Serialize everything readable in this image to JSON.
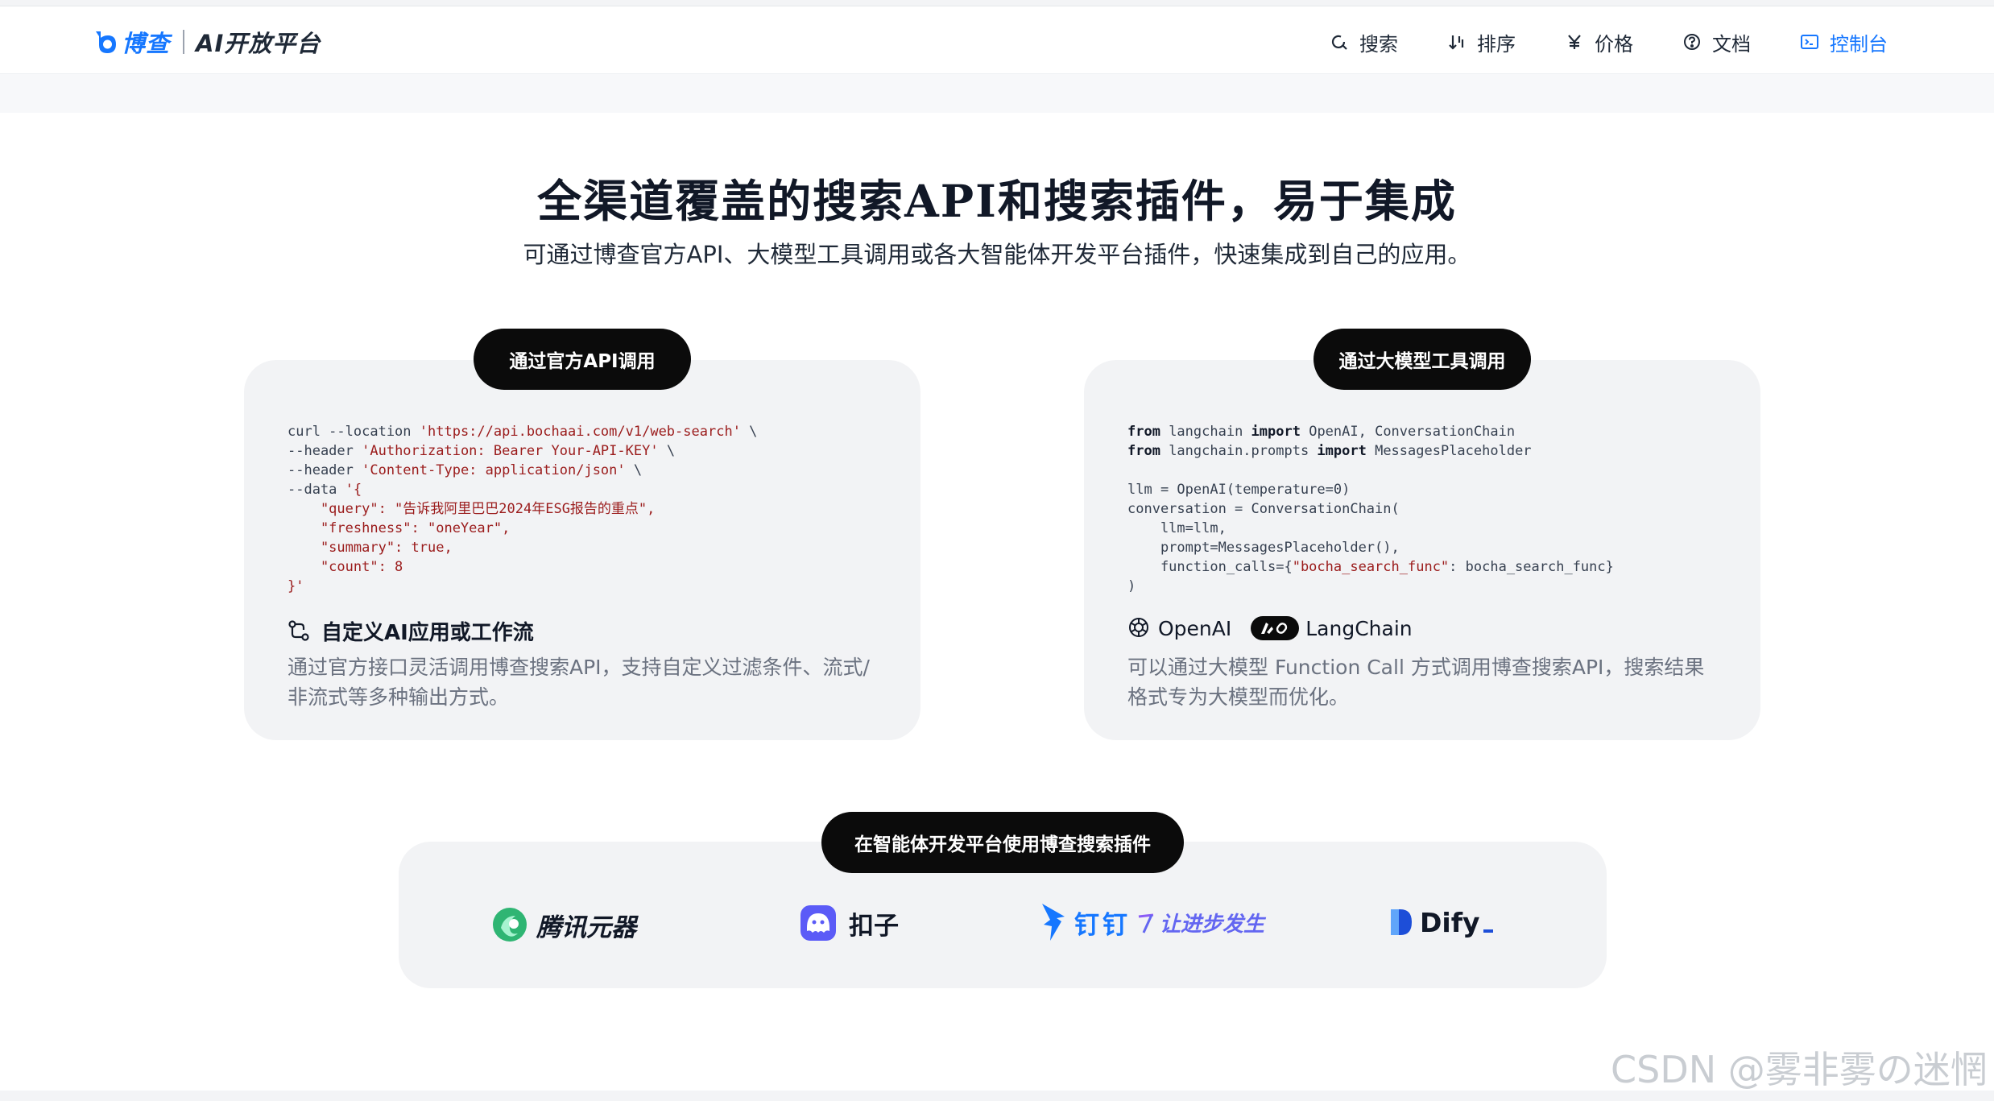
{
  "header": {
    "brand_name": "博查",
    "brand_platform": "AI开放平台",
    "nav": [
      {
        "label": "搜索",
        "icon": "search-icon"
      },
      {
        "label": "排序",
        "icon": "sort-icon"
      },
      {
        "label": "价格",
        "icon": "yen-icon"
      },
      {
        "label": "文档",
        "icon": "help-circle-icon"
      },
      {
        "label": "控制台",
        "icon": "console-icon"
      }
    ],
    "accent_color": "#1677ff"
  },
  "hero": {
    "title": "全渠道覆盖的搜索API和搜索插件，易于集成",
    "subtitle": "可通过博查官方API、大模型工具调用或各大智能体开发平台插件，快速集成到自己的应用。"
  },
  "cards": {
    "official_api": {
      "pill": "通过官方API调用",
      "heading": "自定义AI应用或工作流",
      "description": "通过官方接口灵活调用博查搜索API，支持自定义过滤条件、流式/非流式等多种输出方式。",
      "code": {
        "l1a": "curl --location ",
        "l1b": "'https://api.bochaai.com/v1/web-search'",
        "l1c": " \\",
        "l2a": "--header ",
        "l2b": "'Authorization: Bearer Your-API-KEY'",
        "l2c": " \\",
        "l3a": "--header ",
        "l3b": "'Content-Type: application/json'",
        "l3c": " \\",
        "l4a": "--data ",
        "l4b": "'{",
        "l5": "    \"query\": \"告诉我阿里巴巴2024年ESG报告的重点\",",
        "l6": "    \"freshness\": \"oneYear\",",
        "l7": "    \"summary\": true,",
        "l8": "    \"count\": 8",
        "l9": "}'"
      }
    },
    "llm_tools": {
      "pill": "通过大模型工具调用",
      "openai_label": "OpenAI",
      "langchain_label": "LangChain",
      "description": "可以通过大模型 Function Call 方式调用博查搜索API，搜索结果格式专为大模型而优化。",
      "code": {
        "from": "from",
        "import": "import",
        "l1a": " langchain ",
        "l1c": " OpenAI, ConversationChain",
        "l2a": " langchain.prompts ",
        "l2c": " MessagesPlaceholder",
        "l3": "llm = OpenAI(temperature=0)",
        "l4": "conversation = ConversationChain(",
        "l5": "    llm=llm,",
        "l6": "    prompt=MessagesPlaceholder(),",
        "l7a": "    function_calls={",
        "l7b": "\"bocha_search_func\"",
        "l7c": ": bocha_search_func}",
        "l8": ")"
      }
    },
    "agent_platforms": {
      "pill": "在智能体开发平台使用博查搜索插件",
      "partners": [
        "腾讯元器",
        "扣子",
        "钉钉",
        "让进步发生",
        "Dify"
      ]
    }
  },
  "watermark": "CSDN @雾非雾の迷惘"
}
